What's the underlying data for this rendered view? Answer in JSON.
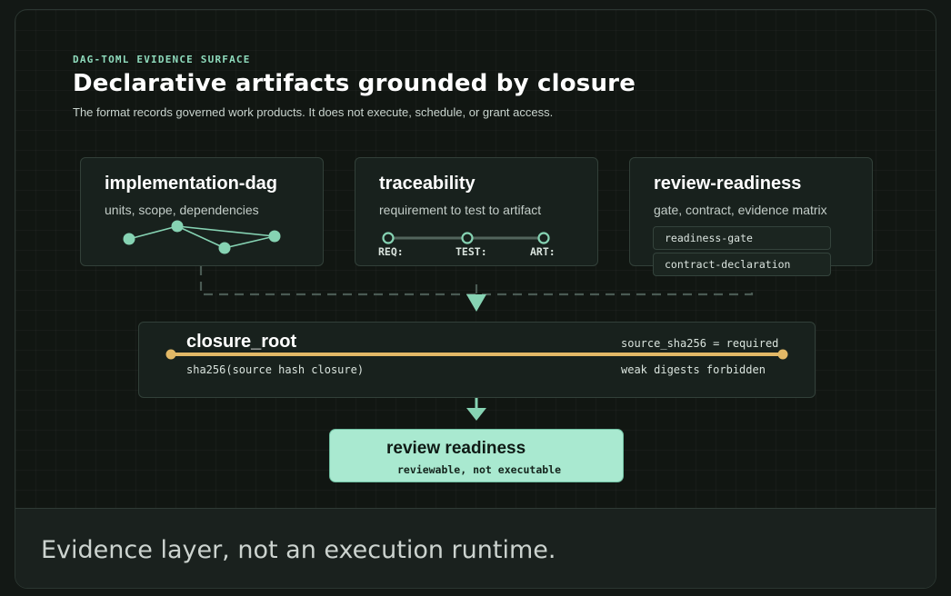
{
  "header": {
    "eyebrow": "DAG-TOML EVIDENCE SURFACE",
    "title": "Declarative artifacts grounded by closure",
    "subtitle": "The format records governed work products. It does not execute, schedule, or grant access."
  },
  "cards": [
    {
      "title": "implementation-dag",
      "subtitle": "units, scope, dependencies"
    },
    {
      "title": "traceability",
      "subtitle": "requirement to test to artifact",
      "chain": [
        "REQ:",
        "TEST:",
        "ART:"
      ]
    },
    {
      "title": "review-readiness",
      "subtitle": "gate, contract, evidence matrix",
      "pills": [
        "readiness-gate",
        "contract-declaration"
      ]
    }
  ],
  "closure": {
    "title": "closure_root",
    "formula": "sha256(source hash closure)",
    "requirement": "source_sha256 = required",
    "constraint": "weak digests forbidden"
  },
  "review": {
    "title": "review readiness",
    "subtitle": "reviewable, not executable"
  },
  "footer": {
    "text": "Evidence layer, not an execution runtime."
  },
  "colors": {
    "accent_mint": "#8fdcbd",
    "node_green": "#86d3b3",
    "closure_gold": "#e2b866",
    "review_fill": "#a9e9d0"
  }
}
